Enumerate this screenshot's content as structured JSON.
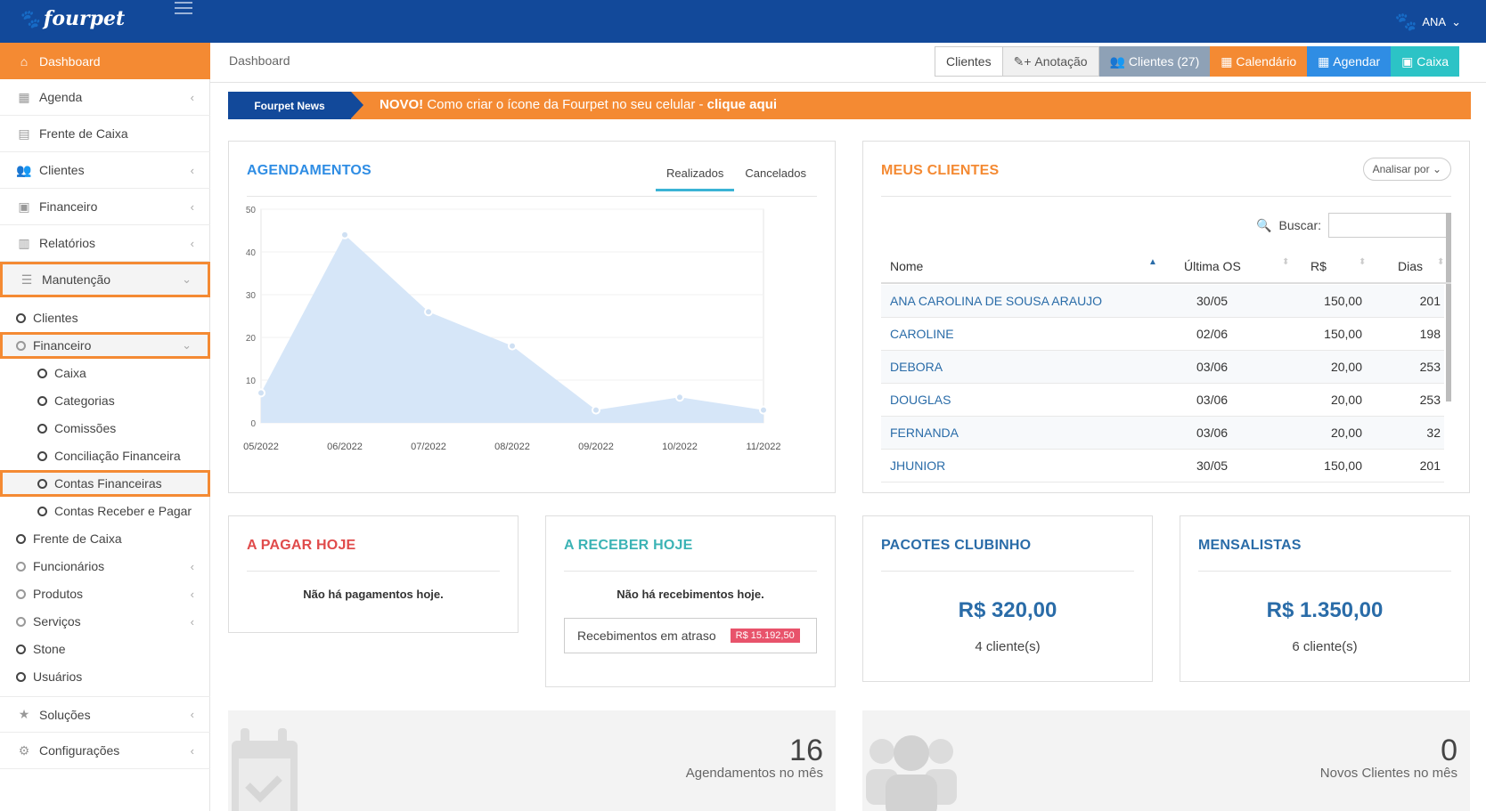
{
  "app": {
    "logo": "fourpet",
    "user": "ANA"
  },
  "colors": {
    "brand_blue": "#12499a",
    "accent_orange": "#f48a33",
    "link_blue": "#2a6ca8"
  },
  "sidebar": {
    "items": [
      {
        "label": "Dashboard",
        "icon": "home-icon"
      },
      {
        "label": "Agenda",
        "icon": "calendar-icon"
      },
      {
        "label": "Frente de Caixa",
        "icon": "cash-register-icon"
      },
      {
        "label": "Clientes",
        "icon": "users-icon"
      },
      {
        "label": "Financeiro",
        "icon": "money-icon"
      },
      {
        "label": "Relatórios",
        "icon": "bar-chart-icon"
      },
      {
        "label": "Manutenção",
        "icon": "database-icon"
      }
    ],
    "submenu": [
      "Clientes",
      "Financeiro",
      "Caixa",
      "Categorias",
      "Comissões",
      "Conciliação Financeira",
      "Contas Financeiras",
      "Contas Receber e Pagar",
      "Frente de Caixa",
      "Funcionários",
      "Produtos",
      "Serviços",
      "Stone",
      "Usuários"
    ],
    "bottom": [
      {
        "label": "Soluções",
        "icon": "star-icon"
      },
      {
        "label": "Configurações",
        "icon": "cogs-icon"
      }
    ]
  },
  "header": {
    "breadcrumb": "Dashboard",
    "buttons": [
      "Clientes",
      "Anotação",
      "Clientes (27)",
      "Calendário",
      "Agendar",
      "Caixa"
    ]
  },
  "news": {
    "label": "Fourpet News",
    "prefix": "NOVO!",
    "text": " Como criar o ícone da Fourpet no seu celular - ",
    "link": "clique aqui"
  },
  "agendamentos": {
    "title": "AGENDAMENTOS",
    "tabs": [
      "Realizados",
      "Cancelados"
    ]
  },
  "chart_data": {
    "type": "area",
    "categories": [
      "05/2022",
      "06/2022",
      "07/2022",
      "08/2022",
      "09/2022",
      "10/2022",
      "11/2022"
    ],
    "values": [
      7,
      44,
      26,
      18,
      3,
      6,
      3
    ],
    "x_points": [
      0,
      1,
      2,
      3,
      4,
      5,
      6
    ],
    "ylim": [
      0,
      50
    ],
    "yticks": [
      0,
      10,
      20,
      30,
      40,
      50
    ],
    "grid": true
  },
  "clientes_card": {
    "title": "MEUS CLIENTES",
    "analyze_label": "Analisar por",
    "search_label": "Buscar:",
    "columns": [
      "Nome",
      "Última OS",
      "R$",
      "Dias"
    ],
    "rows": [
      [
        "ANA CAROLINA DE SOUSA ARAUJO",
        "30/05",
        "150,00",
        "201"
      ],
      [
        "CAROLINE",
        "02/06",
        "150,00",
        "198"
      ],
      [
        "DEBORA",
        "03/06",
        "20,00",
        "253"
      ],
      [
        "DOUGLAS",
        "03/06",
        "20,00",
        "253"
      ],
      [
        "FERNANDA",
        "03/06",
        "20,00",
        "32"
      ],
      [
        "JHUNIOR",
        "30/05",
        "150,00",
        "201"
      ]
    ]
  },
  "pagar": {
    "title": "A PAGAR HOJE",
    "note": "Não há pagamentos hoje."
  },
  "receber": {
    "title": "A RECEBER HOJE",
    "note": "Não há recebimentos hoje.",
    "late_label": "Recebimentos em atraso",
    "late_value": "R$ 15.192,50"
  },
  "pacotes": {
    "title": "PACOTES CLUBINHO",
    "value": "R$ 320,00",
    "sub": "4 cliente(s)"
  },
  "mensalistas": {
    "title": "MENSALISTAS",
    "value": "R$ 1.350,00",
    "sub": "6 cliente(s)"
  },
  "stats": [
    {
      "value": "16",
      "label": "Agendamentos no mês",
      "icon": "calendar-check-icon"
    },
    {
      "value": "0",
      "label": "Novos Clientes no mês",
      "icon": "users-icon"
    }
  ]
}
